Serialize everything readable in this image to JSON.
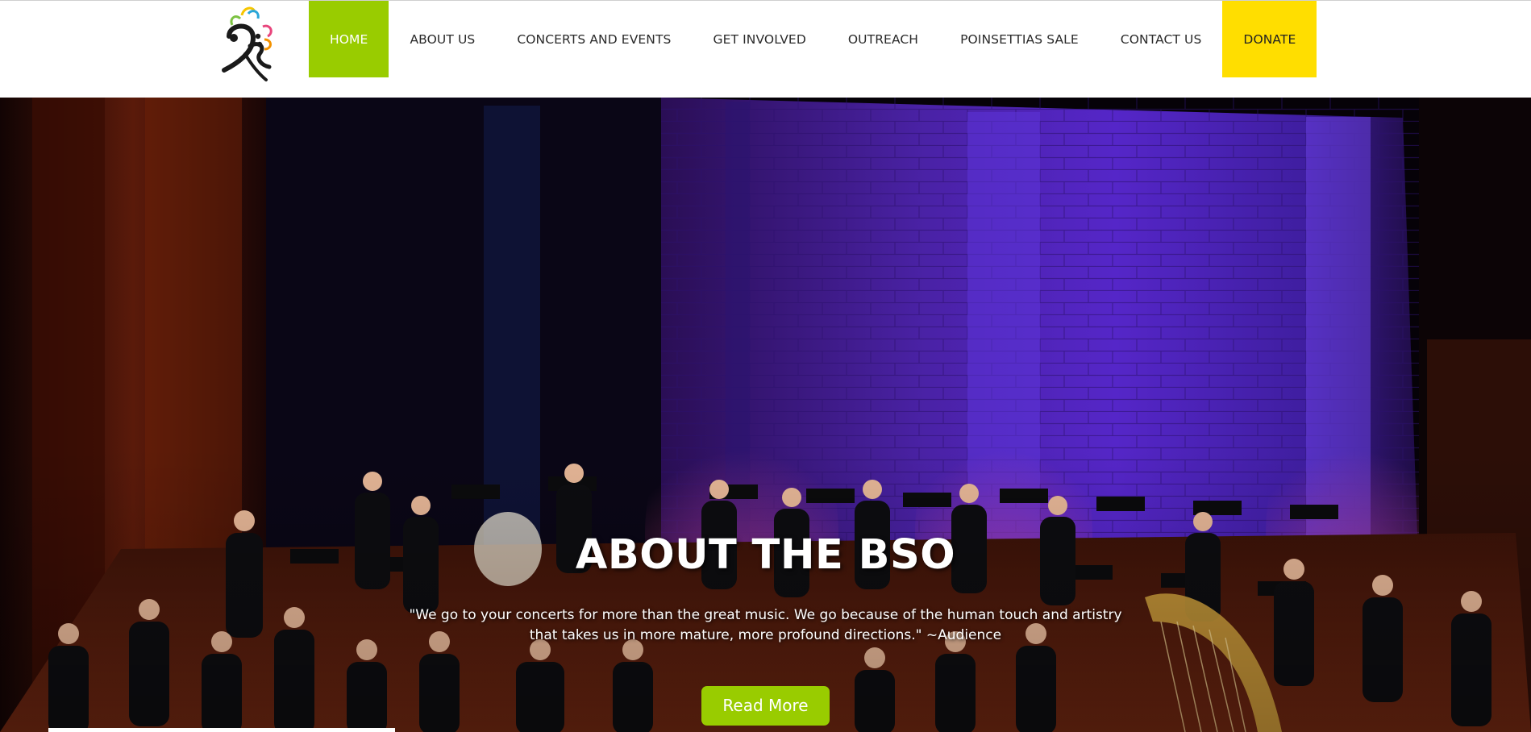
{
  "header": {
    "logo_alt": "Orchestra logo",
    "nav": [
      {
        "label": "HOME",
        "active": true
      },
      {
        "label": "ABOUT US"
      },
      {
        "label": "CONCERTS AND EVENTS"
      },
      {
        "label": "GET INVOLVED"
      },
      {
        "label": "OUTREACH"
      },
      {
        "label": "POINSETTIAS SALE"
      },
      {
        "label": "CONTACT US"
      },
      {
        "label": "DONATE",
        "highlight": true
      }
    ]
  },
  "hero": {
    "title": "ABOUT THE BSO",
    "quote_line1": "\"We go to your concerts for more than the great music. We go because of the human touch and artistry",
    "quote_line2": "that takes us in more mature, more profound directions.\"  ~Audience",
    "button_label": "Read More"
  },
  "colors": {
    "accent_green": "#99cc00",
    "donate_yellow": "#ffde00",
    "header_bg": "#ffffff",
    "hero_text": "#ffffff"
  }
}
